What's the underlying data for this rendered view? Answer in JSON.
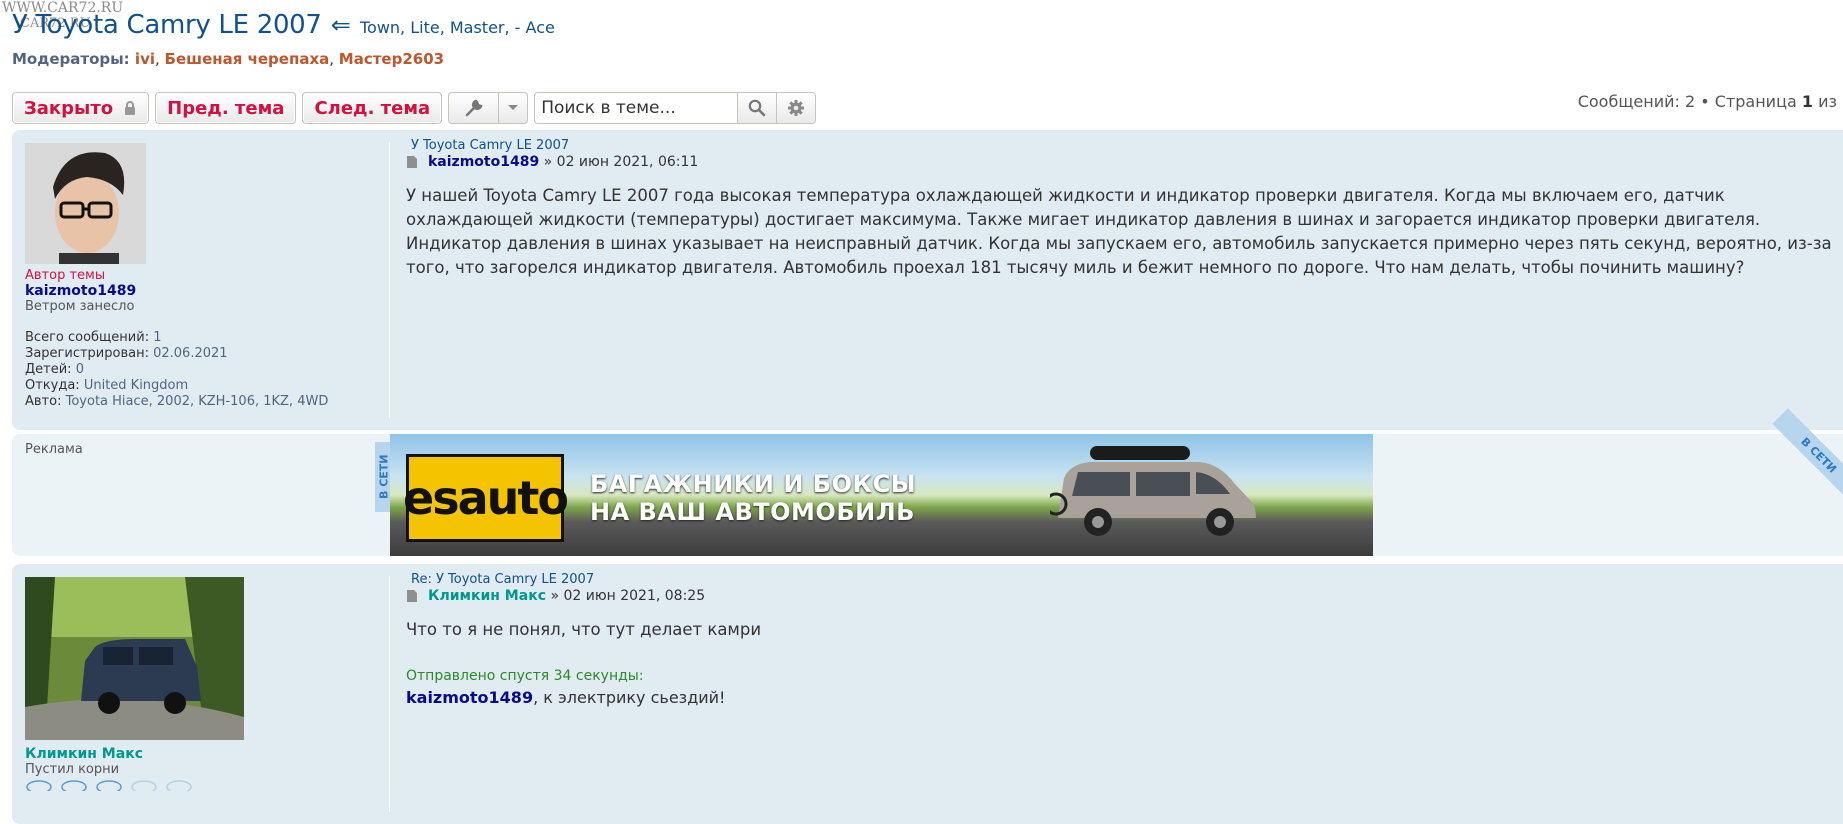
{
  "watermark": {
    "line1": "WWW.CAR72.RU",
    "line2": "CAR72.RU"
  },
  "topic": {
    "title": "У Toyota Camry LE 2007",
    "arrow": "⇐",
    "subtitle": "Town, Lite, Master, - Ace"
  },
  "moderators": {
    "label": "Модераторы:",
    "list": [
      "ivi",
      "Бешеная черепаха",
      "Мастер2603"
    ]
  },
  "action_bar": {
    "closed_label": "Закрыто",
    "prev_label": "Пред. тема",
    "next_label": "След. тема",
    "search_placeholder": "Поиск в теме..."
  },
  "pagination": {
    "text_prefix": "Сообщений: 2 • Страница",
    "page": "1",
    "text_suffix": "из"
  },
  "posts": [
    {
      "title": "У Toyota Camry LE 2007",
      "author": "kaizmoto1489",
      "separator": "»",
      "date": "02 июн 2021, 06:11",
      "author_label": "Автор темы",
      "rank": "Ветром занесло",
      "profile": [
        {
          "label": "Всего сообщений:",
          "value": "1"
        },
        {
          "label": "Зарегистрирован:",
          "value": "02.06.2021"
        },
        {
          "label": "Детей:",
          "value": "0"
        },
        {
          "label": "Откуда:",
          "value": "United Kingdom"
        },
        {
          "label": "Авто:",
          "value": "Toyota Hiace, 2002, KZH-106, 1KZ, 4WD"
        }
      ],
      "content": "У нашей Toyota Camry LE 2007 года высокая температура охлаждающей жидкости и индикатор проверки двигателя. Когда мы включаем его, датчик охлаждающей жидкости (температуры) достигает максимума. Также мигает индикатор давления в шинах и загорается индикатор проверки двигателя. Индикатор давления в шинах указывает на неисправный датчик. Когда мы запускаем его, автомобиль запускается примерно через пять секунд, вероятно, из-за того, что загорелся индикатор двигателя. Автомобиль проехал 181 тысячу миль и бежит немного по дороге. Что нам делать, чтобы починить машину?"
    },
    {
      "title": "Re: У Toyota Camry LE 2007",
      "author": "Климкин Макс",
      "separator": "»",
      "date": "02 июн 2021, 08:25",
      "rank": "Пустил корни",
      "content": "Что то я не понял, что тут делает камри",
      "sent_after": "Отправлено спустя 34 секунды:",
      "mention": "kaizmoto1489",
      "reply_rest": ", к электрику сьездий!"
    }
  ],
  "ad": {
    "label": "Реклама",
    "tab_label": "В СЕТИ",
    "logo_text": "esauto",
    "banner_line1": "БАГАЖНИКИ И БОКСЫ",
    "banner_line2": "НА ВАШ АВТОМОБИЛЬ"
  },
  "colors": {
    "post_bg": "#e1ebf2",
    "button_text": "#d31141",
    "link_blue": "#105289",
    "moderator": "#c0562c"
  }
}
